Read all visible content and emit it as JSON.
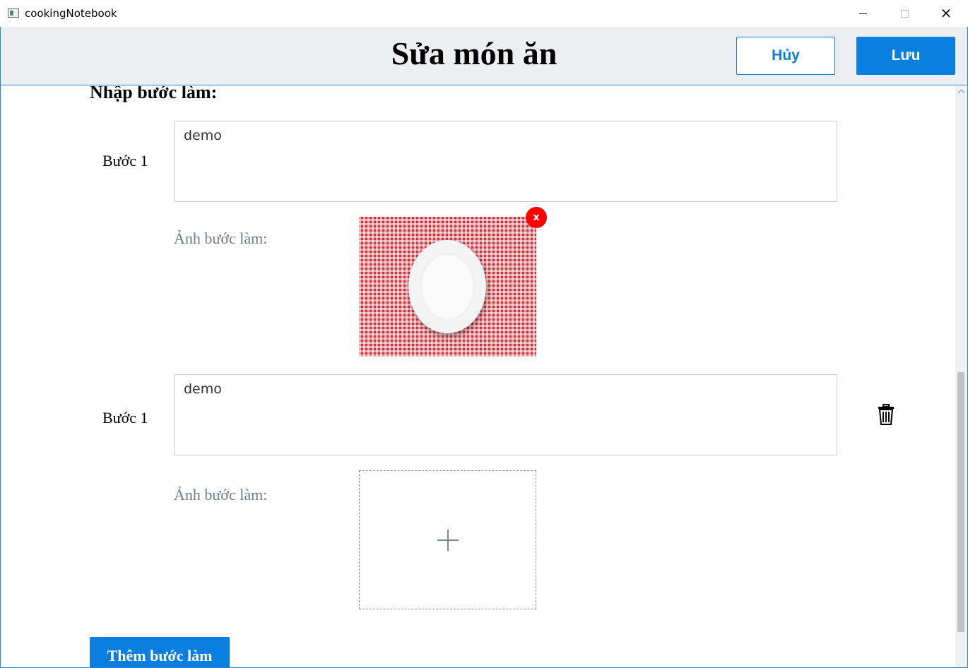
{
  "window": {
    "title": "cookingNotebook",
    "close_glyph": "✕"
  },
  "header": {
    "title": "Sửa món ăn",
    "cancel_label": "Hủy",
    "save_label": "Lưu"
  },
  "form": {
    "section_title": "Nhập bước làm:",
    "steps": [
      {
        "label": "Bước 1",
        "text": "demo",
        "image_label": "Ảnh bước làm:",
        "has_image": true,
        "remove_image_label": "x"
      },
      {
        "label": "Bước 1",
        "text": "demo",
        "image_label": "Ảnh bước làm:",
        "has_image": false,
        "delete_icon": "trash-icon"
      }
    ],
    "add_step_label": "Thêm bước làm"
  },
  "colors": {
    "accent": "#0a7fe0",
    "header_bg": "#eceef1",
    "remove_badge": "#ff0000",
    "muted_label": "#6e7a86"
  }
}
